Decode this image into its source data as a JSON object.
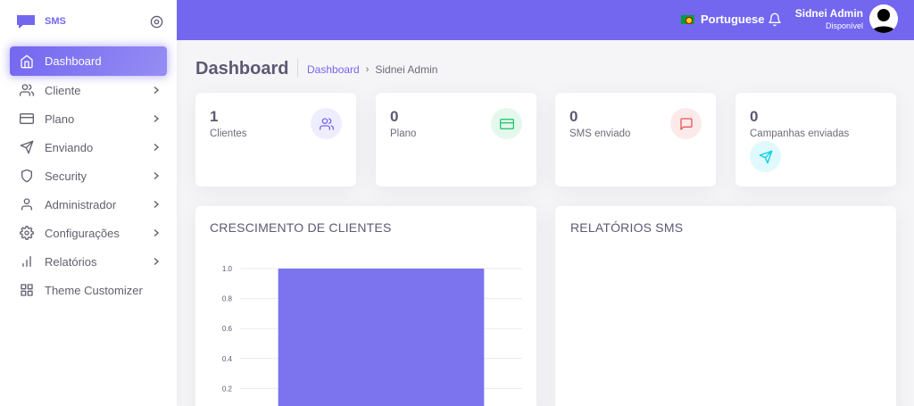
{
  "brand": {
    "name": "SMS"
  },
  "sidebar": {
    "items": [
      {
        "label": "Dashboard",
        "icon": "home-icon",
        "active": true,
        "has_children": false
      },
      {
        "label": "Cliente",
        "icon": "users-icon",
        "active": false,
        "has_children": true
      },
      {
        "label": "Plano",
        "icon": "credit-card-icon",
        "active": false,
        "has_children": true
      },
      {
        "label": "Enviando",
        "icon": "send-icon",
        "active": false,
        "has_children": true
      },
      {
        "label": "Security",
        "icon": "shield-icon",
        "active": false,
        "has_children": true
      },
      {
        "label": "Administrador",
        "icon": "user-icon",
        "active": false,
        "has_children": true
      },
      {
        "label": "Configurações",
        "icon": "gear-icon",
        "active": false,
        "has_children": true
      },
      {
        "label": "Relatórios",
        "icon": "bar-chart-icon",
        "active": false,
        "has_children": true
      },
      {
        "label": "Theme Customizer",
        "icon": "grid-icon",
        "active": false,
        "has_children": false
      }
    ]
  },
  "header": {
    "language": "Portuguese",
    "user_name": "Sidnei Admin",
    "user_status": "Disponível"
  },
  "page": {
    "title": "Dashboard",
    "breadcrumb": [
      "Dashboard",
      "Sidnei Admin"
    ]
  },
  "stats": [
    {
      "value": "1",
      "label": "Clientes",
      "icon": "users-icon",
      "color": "#7367f0",
      "bg": "#eeedfd"
    },
    {
      "value": "0",
      "label": "Plano",
      "icon": "credit-card-icon",
      "color": "#28c76f",
      "bg": "#e5f8ed"
    },
    {
      "value": "0",
      "label": "SMS enviado",
      "icon": "message-square-icon",
      "color": "#ea5455",
      "bg": "#fceaea"
    },
    {
      "value": "0",
      "label": "Campanhas enviadas",
      "icon": "send-icon",
      "color": "#00cfe8",
      "bg": "#e0f9fc"
    }
  ],
  "colors": {
    "accent": "#7367f0",
    "bar": "#7c73ef"
  },
  "charts": {
    "growth_title": "CRESCIMENTO DE CLIENTES",
    "sms_title": "RELATÓRIOS SMS"
  },
  "chart_data": {
    "type": "bar",
    "categories": [
      ""
    ],
    "values": [
      1
    ],
    "title": "CRESCIMENTO DE CLIENTES",
    "xlabel": "",
    "ylabel": "",
    "ylim": [
      0,
      1
    ],
    "yticks": [
      "1.0",
      "0.8",
      "0.6",
      "0.4",
      "0.2"
    ],
    "grid": true
  }
}
